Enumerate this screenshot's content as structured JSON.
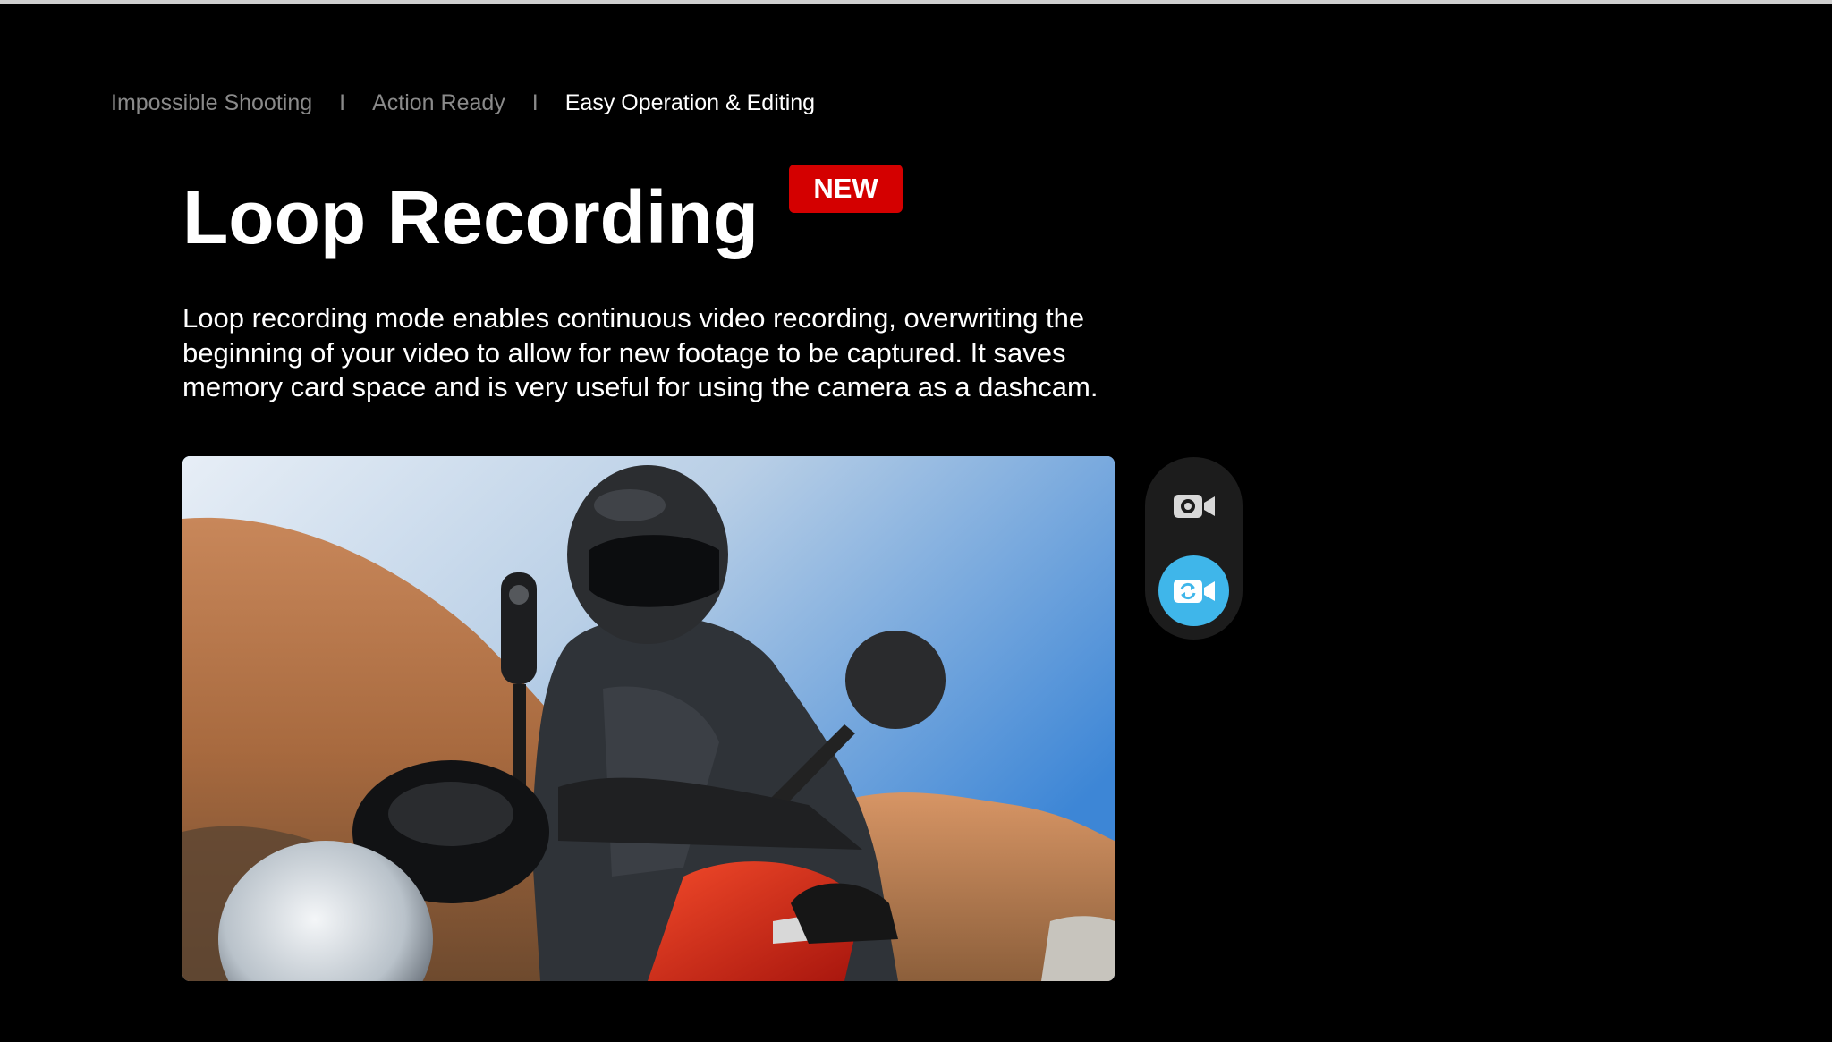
{
  "tabs": [
    {
      "label": "Impossible Shooting",
      "active": false
    },
    {
      "label": "Action Ready",
      "active": false
    },
    {
      "label": "Easy Operation & Editing",
      "active": true
    }
  ],
  "separator": "I",
  "feature": {
    "title": "Loop Recording",
    "badge": "NEW",
    "description": "Loop recording mode enables continuous video recording, overwriting the beginning of your video to allow for new footage to be captured. It saves memory card space and is very useful for using the camera as a dashcam."
  },
  "media": {
    "image_subject": "motorcyclist-with-helmet-mounted-360-camera"
  },
  "mode_toggle": {
    "options": [
      {
        "icon": "video-camera-icon",
        "selected": false
      },
      {
        "icon": "loop-video-camera-icon",
        "selected": true
      }
    ],
    "accent_color": "#3fb6ea"
  },
  "colors": {
    "background": "#000000",
    "badge": "#d40000",
    "inactive_tab": "#8a8a8a"
  }
}
